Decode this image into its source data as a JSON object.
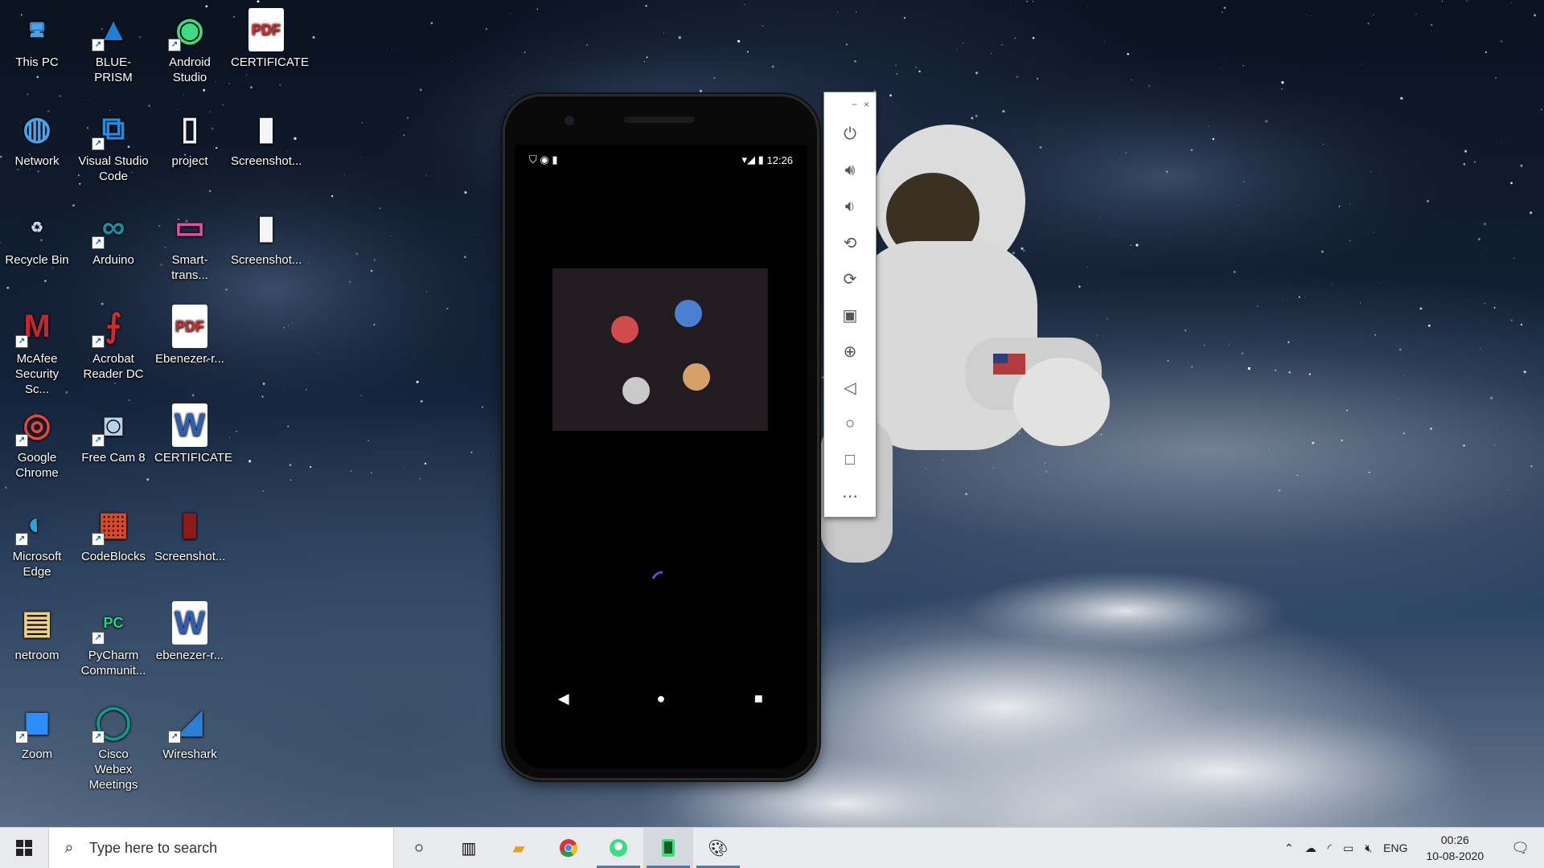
{
  "desktop": {
    "icons": [
      {
        "label": "This PC"
      },
      {
        "label": "BLUE-PRISM"
      },
      {
        "label": "Android Studio"
      },
      {
        "label": "CERTIFICATE"
      },
      {
        "label": "Network"
      },
      {
        "label": "Visual Studio Code"
      },
      {
        "label": "project"
      },
      {
        "label": "Screenshot..."
      },
      {
        "label": "Recycle Bin"
      },
      {
        "label": "Arduino"
      },
      {
        "label": "Smart-trans..."
      },
      {
        "label": "Screenshot..."
      },
      {
        "label": "McAfee Security Sc..."
      },
      {
        "label": "Acrobat Reader DC"
      },
      {
        "label": "Ebenezer-r..."
      },
      {
        "label": "Google Chrome"
      },
      {
        "label": "Free Cam 8"
      },
      {
        "label": "CERTIFICATE"
      },
      {
        "label": "Microsoft Edge"
      },
      {
        "label": "CodeBlocks"
      },
      {
        "label": "Screenshot..."
      },
      {
        "label": "netroom"
      },
      {
        "label": "PyCharm Communit..."
      },
      {
        "label": "ebenezer-r..."
      },
      {
        "label": "Zoom"
      },
      {
        "label": "Cisco Webex Meetings"
      },
      {
        "label": "Wireshark"
      }
    ]
  },
  "emulator": {
    "status_time": "12:26",
    "circle_colors": {
      "red": "#d24b4b",
      "blue": "#4a7fd4",
      "grey": "#c9c9c9",
      "tan": "#d6a06a"
    },
    "toolbar": {
      "minimize": "−",
      "close": "×",
      "buttons": [
        "power-icon",
        "volume-up-icon",
        "volume-down-icon",
        "rotate-left-icon",
        "rotate-right-icon",
        "camera-icon",
        "zoom-icon",
        "back-icon",
        "home-icon",
        "overview-icon",
        "more-icon"
      ]
    }
  },
  "taskbar": {
    "search_placeholder": "Type here to search",
    "language": "ENG",
    "time": "00:26",
    "date": "10-08-2020"
  }
}
